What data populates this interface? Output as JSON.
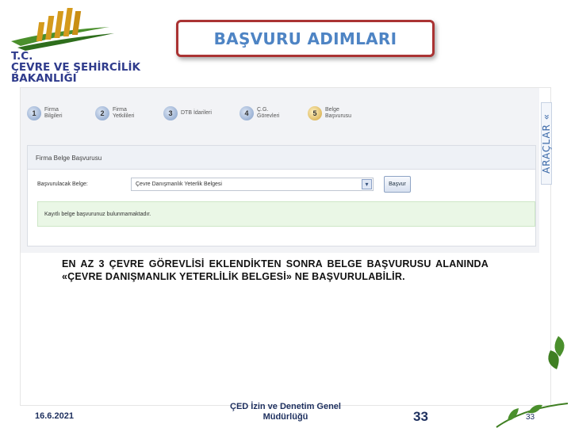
{
  "logo": {
    "line1": "T.C.",
    "line2": "ÇEVRE VE ŞEHİRCİLİK",
    "line3": "BAKANLIĞI",
    "icon": "building-logo-icon"
  },
  "title": "BAŞVURU ADIMLARI",
  "wizard": {
    "steps": [
      {
        "num": "1",
        "line1": "Firma",
        "line2": "Bilgileri",
        "icon": "step-1-icon"
      },
      {
        "num": "2",
        "line1": "Firma",
        "line2": "Yetkilileri",
        "icon": "step-2-icon"
      },
      {
        "num": "3",
        "line1": "DTB İdarileri",
        "line2": "",
        "icon": "step-3-icon"
      },
      {
        "num": "4",
        "line1": "Ç.G.",
        "line2": "Görevleri",
        "icon": "step-4-icon"
      },
      {
        "num": "5",
        "line1": "Belge",
        "line2": "Başvurusu",
        "icon": "step-5-icon"
      }
    ]
  },
  "form": {
    "header": "Firma Belge Başvurusu",
    "label": "Başvurulacak Belge:",
    "select_value": "Çevre Danışmanlık Yeterlik Belgesi",
    "apply_label": "Başvur",
    "info_text": "Kayıtlı belge başvurunuz bulunmamaktadır."
  },
  "side_tab": "ARAÇLAR «",
  "note": "EN AZ 3  ÇEVRE GÖREVLİSİ EKLENDİKTEN SONRA BELGE BAŞVURUSU ALANINDA «ÇEVRE DANIŞMANLIK YETERLİLİK BELGESİ» NE BAŞVURULABİLİR.",
  "footer": {
    "date": "16.6.2021",
    "org_line1": "ÇED İzin ve Denetim Genel",
    "org_line2": "Müdürlüğü",
    "page_number": "33",
    "page_number_small": "33"
  },
  "colors": {
    "title_text": "#4e84c4",
    "title_border": "#aa3333",
    "logo_text": "#2f3b8c",
    "logo_green": "#4a8f2c",
    "logo_gold": "#d49a1c"
  }
}
